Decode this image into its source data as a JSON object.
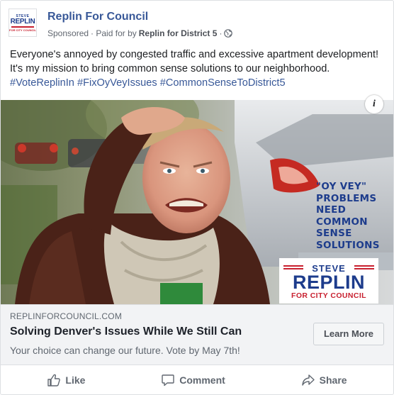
{
  "post": {
    "page_name": "Replin For Council",
    "sponsored": "Sponsored",
    "paid_prefix": "· Paid for by",
    "paid_by": "Replin for District 5",
    "paid_suffix": "·",
    "more_icon": "more-dots-icon",
    "globe_icon": "globe-icon",
    "avatar": {
      "top": "STEVE",
      "name": "REPLIN",
      "bottom": "FOR CITY COUNCIL"
    },
    "text_main": "Everyone's annoyed by congested traffic and excessive apartment development! It's my mission to bring common sense solutions to our neighborhood.",
    "hashtags": [
      "#VoteReplinIn",
      "#FixOyVeyIssues",
      "#CommonSenseToDistrict5"
    ]
  },
  "ad_image": {
    "info_label": "i",
    "slogan_lines": [
      "\"OY VEY\"",
      "PROBLEMS",
      "NEED",
      "COMMON",
      "SENSE",
      "SOLUTIONS"
    ],
    "logo": {
      "first": "STEVE",
      "name": "REPLIN",
      "office": "FOR CITY COUNCIL"
    }
  },
  "link_preview": {
    "domain": "REPLINFORCOUNCIL.COM",
    "title": "Solving Denver's Issues While We Still Can",
    "description": "Your choice can change our future. Vote by May 7th!",
    "button_label": "Learn More"
  },
  "actions": [
    {
      "label": "Like",
      "icon": "thumbs-up-icon"
    },
    {
      "label": "Comment",
      "icon": "comment-icon"
    },
    {
      "label": "Share",
      "icon": "share-icon"
    }
  ],
  "colors": {
    "link_blue": "#385898",
    "brand_navy": "#1d3c8c",
    "brand_red": "#c8202f",
    "meta_gray": "#616770"
  }
}
